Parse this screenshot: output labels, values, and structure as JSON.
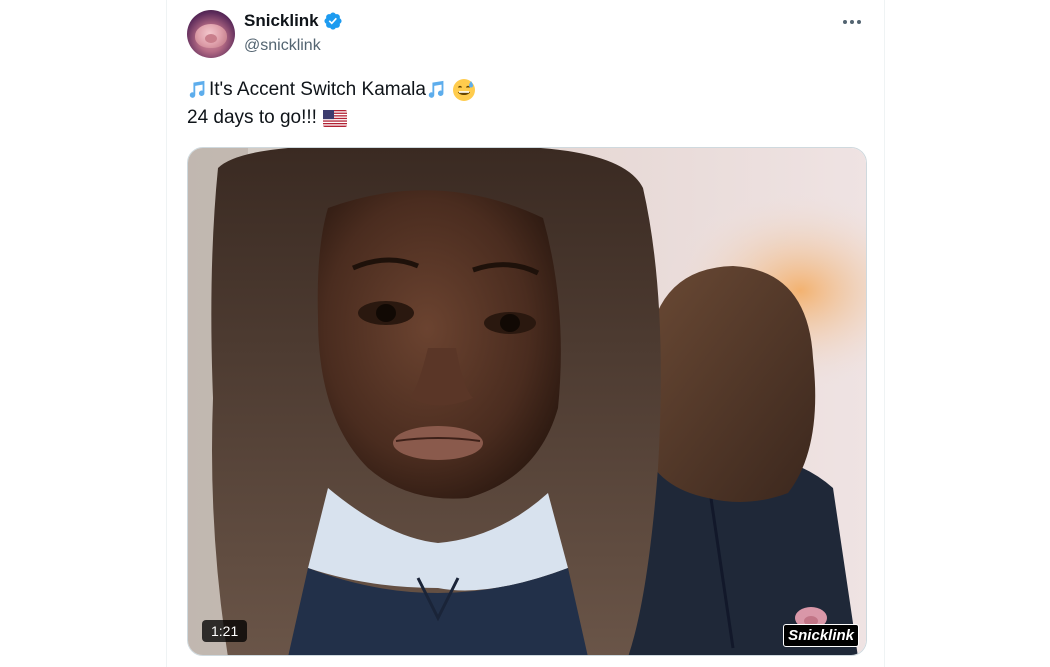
{
  "tweet": {
    "display_name": "Snicklink",
    "handle": "@snicklink",
    "verified_icon": "verified-badge-icon",
    "more_icon": "more-options-icon",
    "text_line1": "It's Accent Switch Kamala",
    "text_line2": "24 days to go!!!",
    "emojis": [
      "musical-notes",
      "grinning-sweat",
      "us-flag"
    ]
  },
  "media": {
    "duration": "1:21",
    "watermark": "Snicklink"
  },
  "colors": {
    "text": "#0f1419",
    "secondary": "#536471",
    "verified": "#1d9bf0",
    "border": "#cfd9de"
  }
}
